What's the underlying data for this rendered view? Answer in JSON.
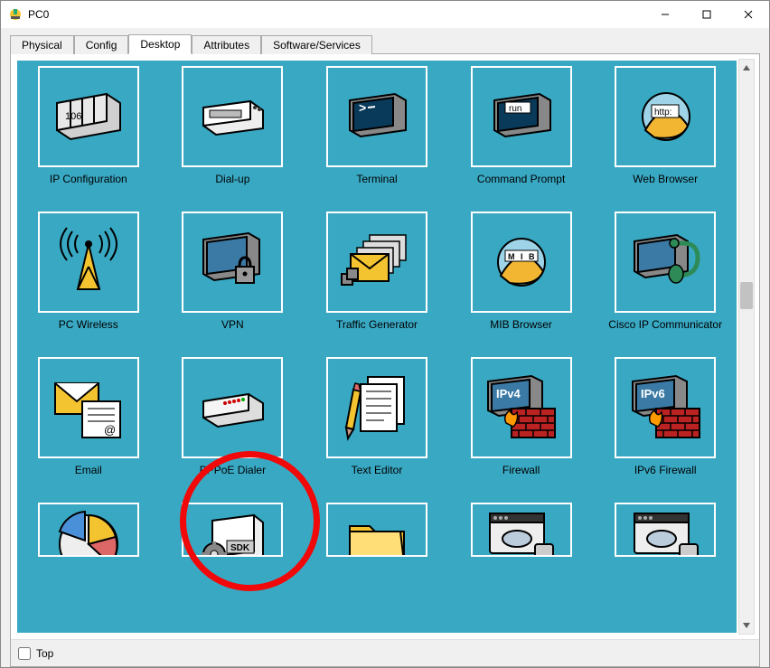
{
  "window": {
    "title": "PC0"
  },
  "titlebar_buttons": {
    "min": "minimize",
    "max": "maximize",
    "close": "close"
  },
  "tabs": {
    "items": [
      {
        "label": "Physical"
      },
      {
        "label": "Config"
      },
      {
        "label": "Desktop"
      },
      {
        "label": "Attributes"
      },
      {
        "label": "Software/Services"
      }
    ],
    "active_index": 2
  },
  "desktop_apps": {
    "row1": [
      {
        "label": "IP Configuration",
        "icon": "ip-config-icon"
      },
      {
        "label": "Dial-up",
        "icon": "dialup-icon"
      },
      {
        "label": "Terminal",
        "icon": "terminal-icon"
      },
      {
        "label": "Command Prompt",
        "icon": "cmd-icon"
      },
      {
        "label": "Web Browser",
        "icon": "browser-icon"
      }
    ],
    "row2": [
      {
        "label": "PC Wireless",
        "icon": "wireless-icon"
      },
      {
        "label": "VPN",
        "icon": "vpn-icon"
      },
      {
        "label": "Traffic Generator",
        "icon": "traffic-icon"
      },
      {
        "label": "MIB Browser",
        "icon": "mib-icon"
      },
      {
        "label": "Cisco IP Communicator",
        "icon": "ipcomm-icon"
      }
    ],
    "row3": [
      {
        "label": "Email",
        "icon": "email-icon"
      },
      {
        "label": "PPPoE Dialer",
        "icon": "pppoe-icon"
      },
      {
        "label": "Text Editor",
        "icon": "texteditor-icon"
      },
      {
        "label": "Firewall",
        "icon": "firewall-icon",
        "badge": "IPv4"
      },
      {
        "label": "IPv6 Firewall",
        "icon": "firewall6-icon",
        "badge": "IPv6"
      }
    ],
    "row4_partial": [
      {
        "label": "",
        "icon": "piechart-icon"
      },
      {
        "label": "",
        "icon": "sdk-icon",
        "badge": "SDK"
      },
      {
        "label": "",
        "icon": "folder-icon"
      },
      {
        "label": "",
        "icon": "cloud-pc-icon"
      },
      {
        "label": "",
        "icon": "cloud-pc2-icon"
      }
    ]
  },
  "icon_text": {
    "ipconfig_number": "106",
    "cmd_text": "run",
    "browser_text": "http:",
    "mib_text": "M I B",
    "firewall4_text": "IPv4",
    "firewall6_text": "IPv6",
    "sdk_text": "SDK"
  },
  "bottombar": {
    "checkbox_label": "Top",
    "checked": false
  },
  "highlight": {
    "target": "PPPoE Dialer"
  }
}
